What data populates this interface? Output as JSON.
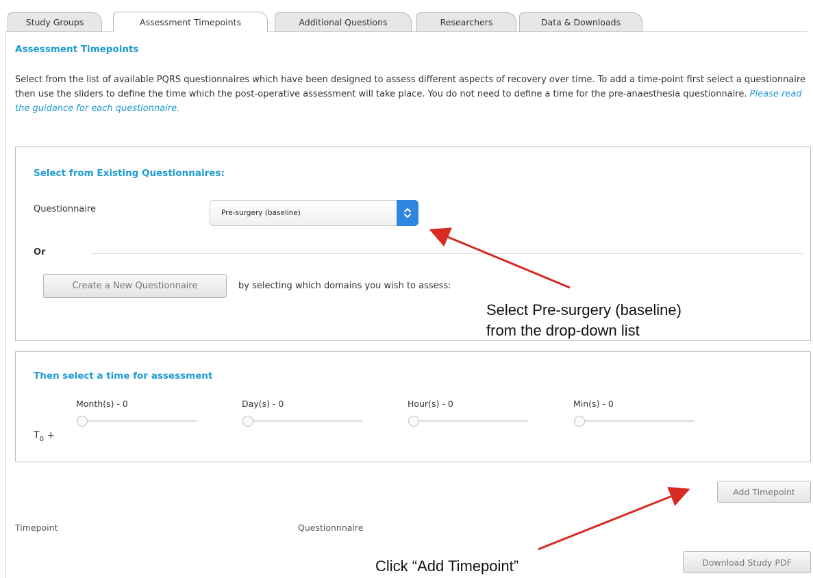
{
  "tabs": [
    "Study Groups",
    "Assessment Timepoints",
    "Additional Questions",
    "Researchers",
    "Data & Downloads"
  ],
  "active_tab": "Assessment Timepoints",
  "section_title": "Assessment Timepoints",
  "intro": {
    "text": "Select from the list of available PQRS questionnaires which have been designed to assess different aspects of recovery over time. To add a time-point first select a questionnaire then use the sliders to define the time which the post-operative assessment will take place. You do not need to define a time for the pre-anaesthesia questionnaire.",
    "link": "Please read the guidance for each questionnaire."
  },
  "select_panel": {
    "title": "Select from Existing Questionnaires:",
    "questionnaire_label": "Questionnaire",
    "selected_questionnaire": "Pre-surgery (baseline)",
    "or_label": "Or",
    "create_button": "Create a New Questionnaire",
    "create_hint": "by selecting which domains you wish to assess:"
  },
  "time_panel": {
    "title": "Then select a time for assessment",
    "t0_label": "T",
    "t0_sub": "0",
    "t0_suffix": " +",
    "sliders": [
      {
        "label": "Month(s) - 0",
        "value": 0
      },
      {
        "label": "Day(s) - 0",
        "value": 0
      },
      {
        "label": "Hour(s) - 0",
        "value": 0
      },
      {
        "label": "Min(s) - 0",
        "value": 0
      }
    ]
  },
  "add_timepoint_button": "Add Timepoint",
  "table_headers": {
    "timepoint": "Timepoint",
    "questionnaire": "Questionnnaire"
  },
  "download_button": "Download Study PDF",
  "annotations": {
    "select_note_line1": "Select Pre-surgery (baseline)",
    "select_note_line2": "from the drop-down list",
    "click_note": "Click “Add Timepoint”"
  },
  "colors": {
    "accent": "#1f9bd1",
    "select_button": "#2f86e0",
    "arrow": "#d62a22"
  },
  "icons": {
    "select_arrows": "up-down-chevron-icon"
  }
}
